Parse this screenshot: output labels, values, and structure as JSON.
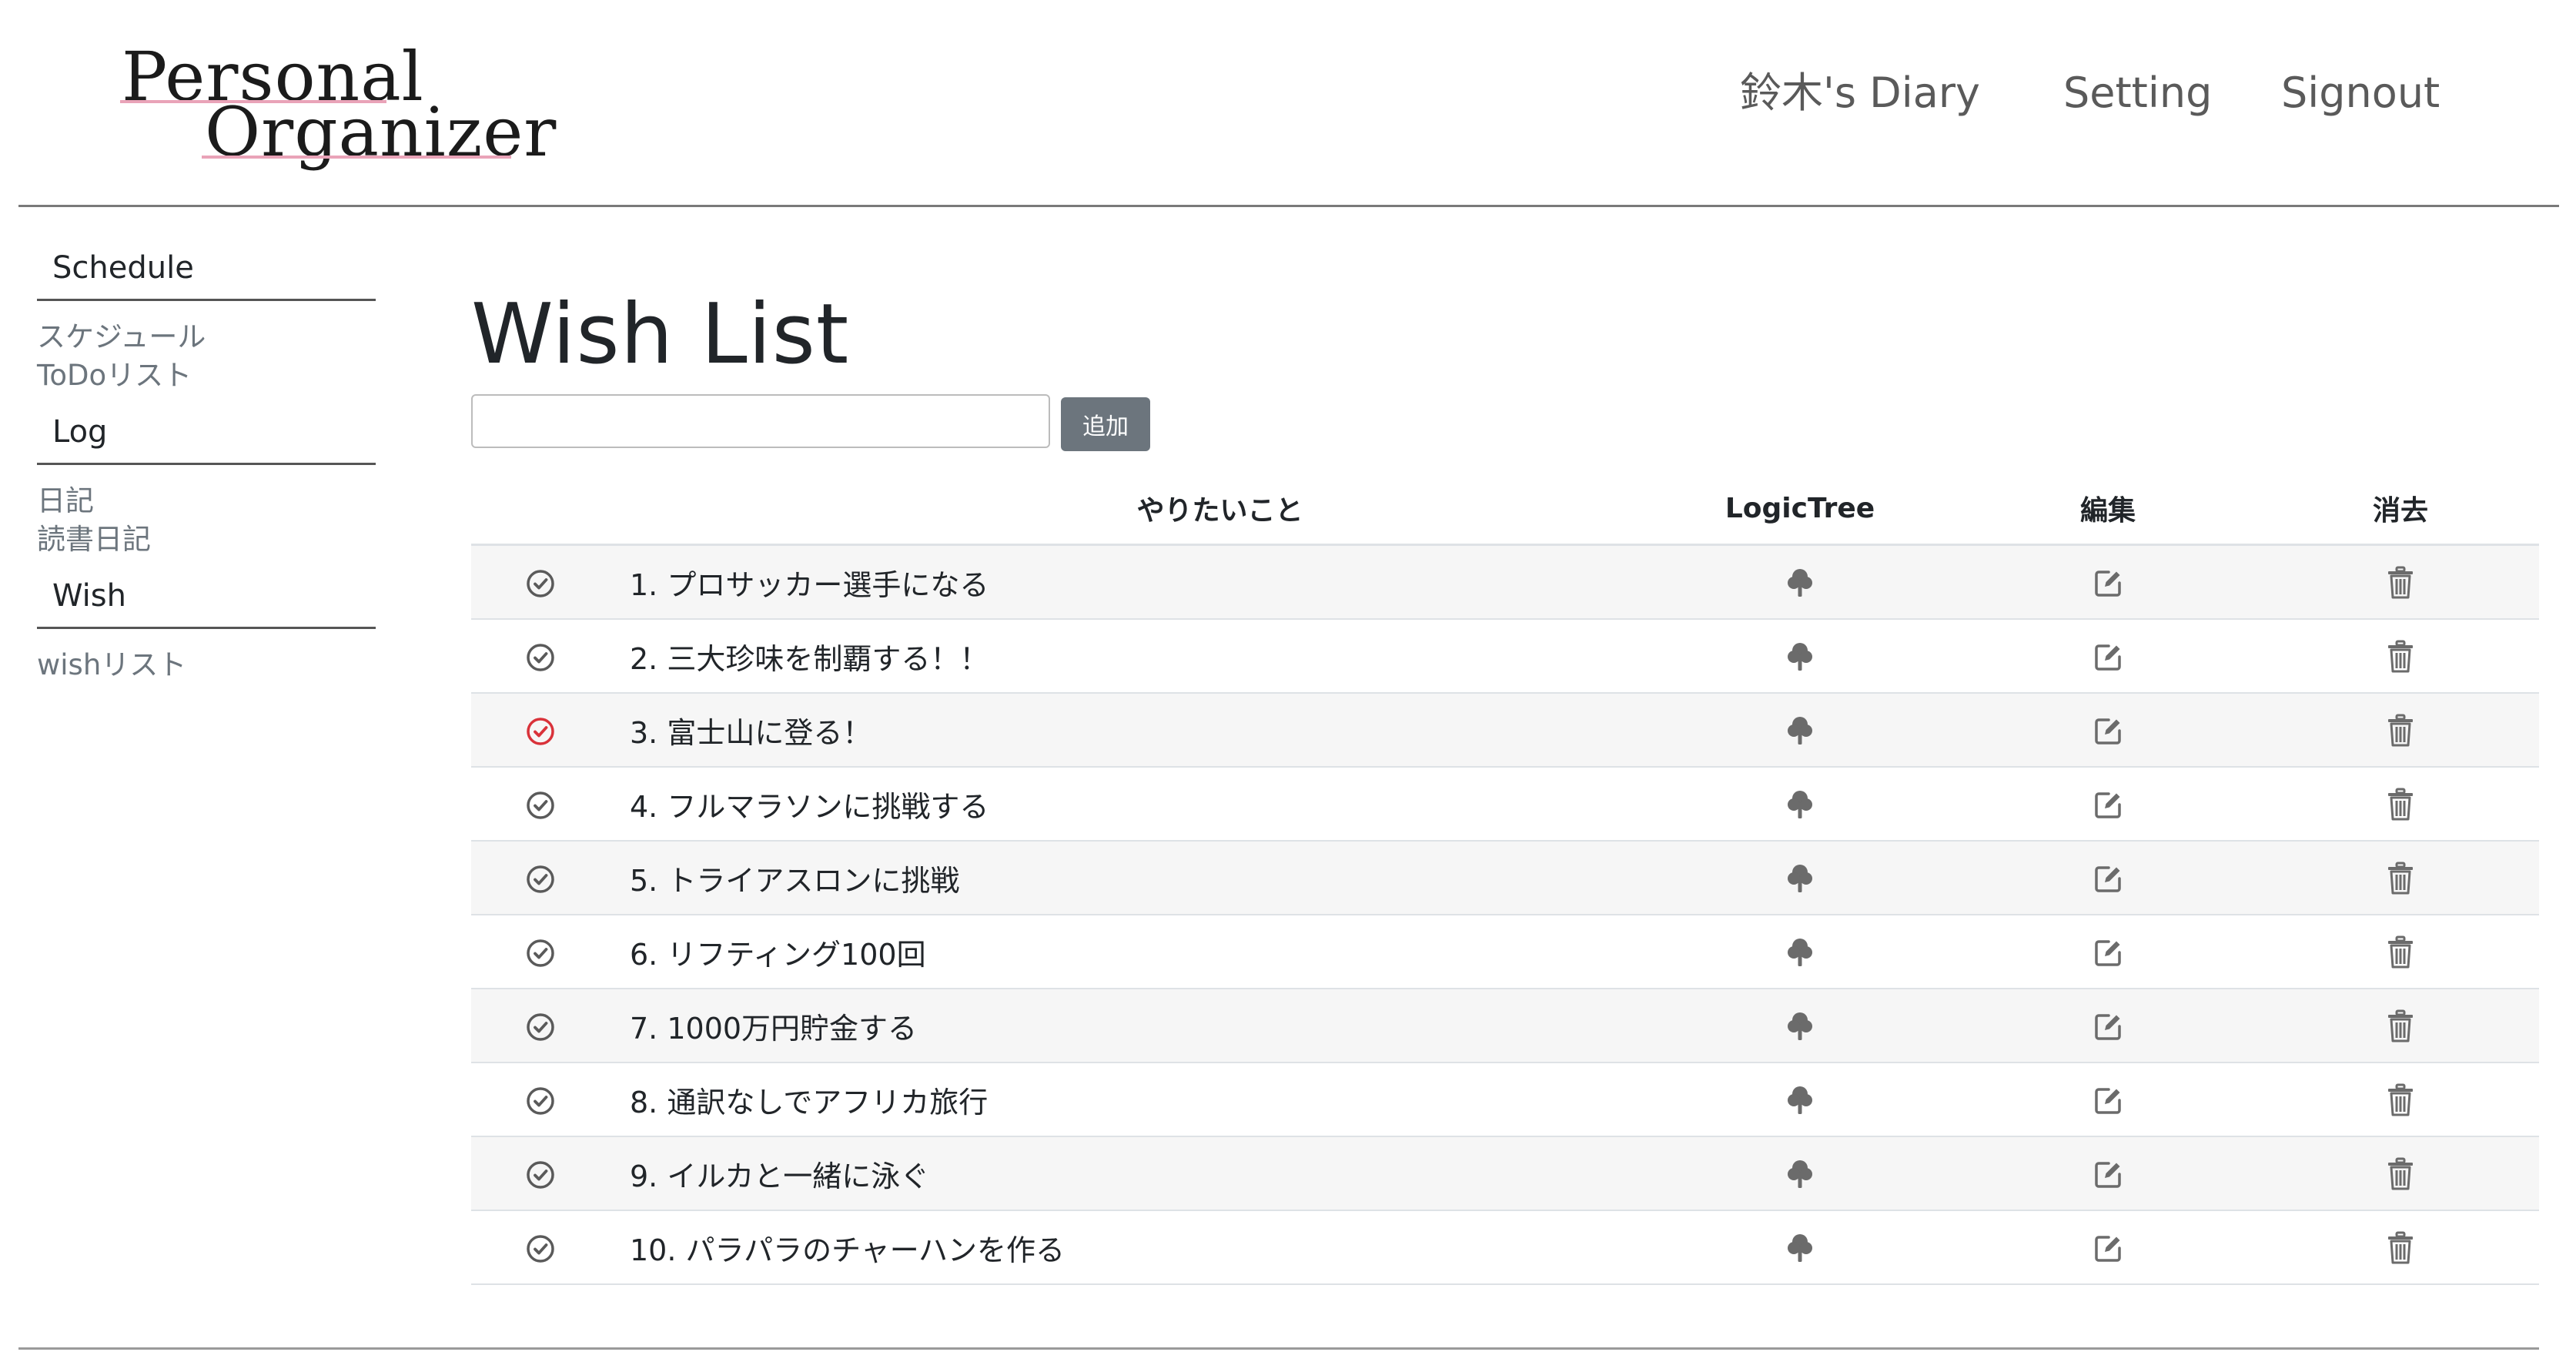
{
  "header": {
    "logo_line1": "Personal",
    "logo_line2": "Organizer",
    "nav": [
      {
        "label": "鈴木's Diary"
      },
      {
        "label": "Setting"
      },
      {
        "label": "Signout"
      }
    ]
  },
  "sidebar": {
    "sections": [
      {
        "title": "Schedule",
        "links": [
          "スケジュール",
          "ToDoリスト"
        ]
      },
      {
        "title": "Log",
        "links": [
          "日記",
          "読書日記"
        ]
      },
      {
        "title": "Wish",
        "links": [
          "wishリスト"
        ]
      }
    ]
  },
  "main": {
    "title": "Wish List",
    "input_value": "",
    "add_label": "追加",
    "columns": {
      "todo": "やりたいこと",
      "logictree": "LogicTree",
      "edit": "編集",
      "delete": "消去"
    },
    "items": [
      {
        "text": "1. プロサッカー選手になる",
        "done": false
      },
      {
        "text": "2. 三大珍味を制覇する！！",
        "done": false
      },
      {
        "text": "3. 富士山に登る！",
        "done": true
      },
      {
        "text": "4. フルマラソンに挑戦する",
        "done": false
      },
      {
        "text": "5. トライアスロンに挑戦",
        "done": false
      },
      {
        "text": "6. リフティング100回",
        "done": false
      },
      {
        "text": "7. 1000万円貯金する",
        "done": false
      },
      {
        "text": "8. 通訳なしでアフリカ旅行",
        "done": false
      },
      {
        "text": "9. イルカと一緒に泳ぐ",
        "done": false
      },
      {
        "text": "10. パラパラのチャーハンを作る",
        "done": false
      }
    ]
  },
  "colors": {
    "check_default": "#5a5a5a",
    "check_done": "#d9323a",
    "icon_gray": "#6b6b6b",
    "button": "#6c757d",
    "logo_underline": "#e9a3b8"
  },
  "icons": {
    "check": "check-circle-icon",
    "tree": "tree-icon",
    "edit": "edit-icon",
    "delete": "trash-icon"
  }
}
